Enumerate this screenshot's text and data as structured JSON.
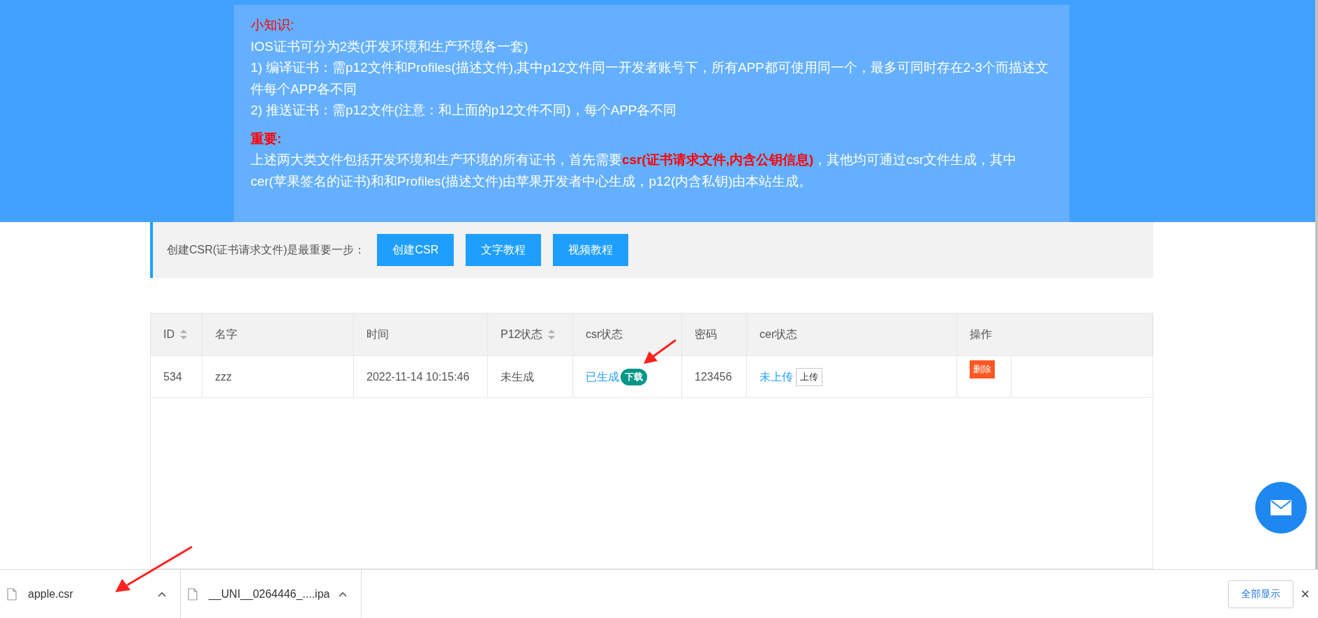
{
  "notice": {
    "title": "小知识:",
    "lines": [
      "IOS证书可分为2类(开发环境和生产环境各一套)",
      "1) 编译证书：需p12文件和Profiles(描述文件),其中p12文件同一开发者账号下，所有APP都可使用同一个，最多可同时存在2-3个而描述文件每个APP各不同",
      "2) 推送证书：需p12文件(注意：和上面的p12文件不同)，每个APP各不同"
    ],
    "important_title": "重要:",
    "important_text": "上述两大类文件包括开发环境和生产环境的所有证书，首先需要**csr(证书请求文件,内含公钥信息)**，其他均可通过csr文件生成，其中cer(苹果签名的证书)和和Profiles(描述文件)由苹果开发者中心生成，p12(内含私钥)由本站生成。"
  },
  "csr_bar": {
    "label": "创建CSR(证书请求文件)是最重要一步：",
    "buttons": [
      "创建CSR",
      "文字教程",
      "视频教程"
    ]
  },
  "table": {
    "columns": [
      {
        "label": "ID",
        "kind": "sortable"
      },
      {
        "label": "名字",
        "kind": "plain"
      },
      {
        "label": "时间",
        "kind": "plain"
      },
      {
        "label": "P12状态",
        "kind": "sortable"
      },
      {
        "label": "csr状态",
        "kind": "plain"
      },
      {
        "label": "密码",
        "kind": "plain"
      },
      {
        "label": "cer状态",
        "kind": "plain"
      },
      {
        "label": "操作",
        "kind": "plain"
      }
    ],
    "rows": [
      {
        "id": "534",
        "name": "zzz",
        "time": "2022-11-14 10:15:46",
        "p12_status": "未生成",
        "csr_status": "已生成",
        "csr_action": "下载",
        "password": "123456",
        "cer_status": "未上传",
        "cer_action": "上传",
        "operation": "删除"
      }
    ]
  },
  "downloads": {
    "items": [
      {
        "file": "apple.csr"
      },
      {
        "file": "__UNI__0264446_....ipa"
      }
    ],
    "show_all": "全部显示",
    "close": "×"
  }
}
